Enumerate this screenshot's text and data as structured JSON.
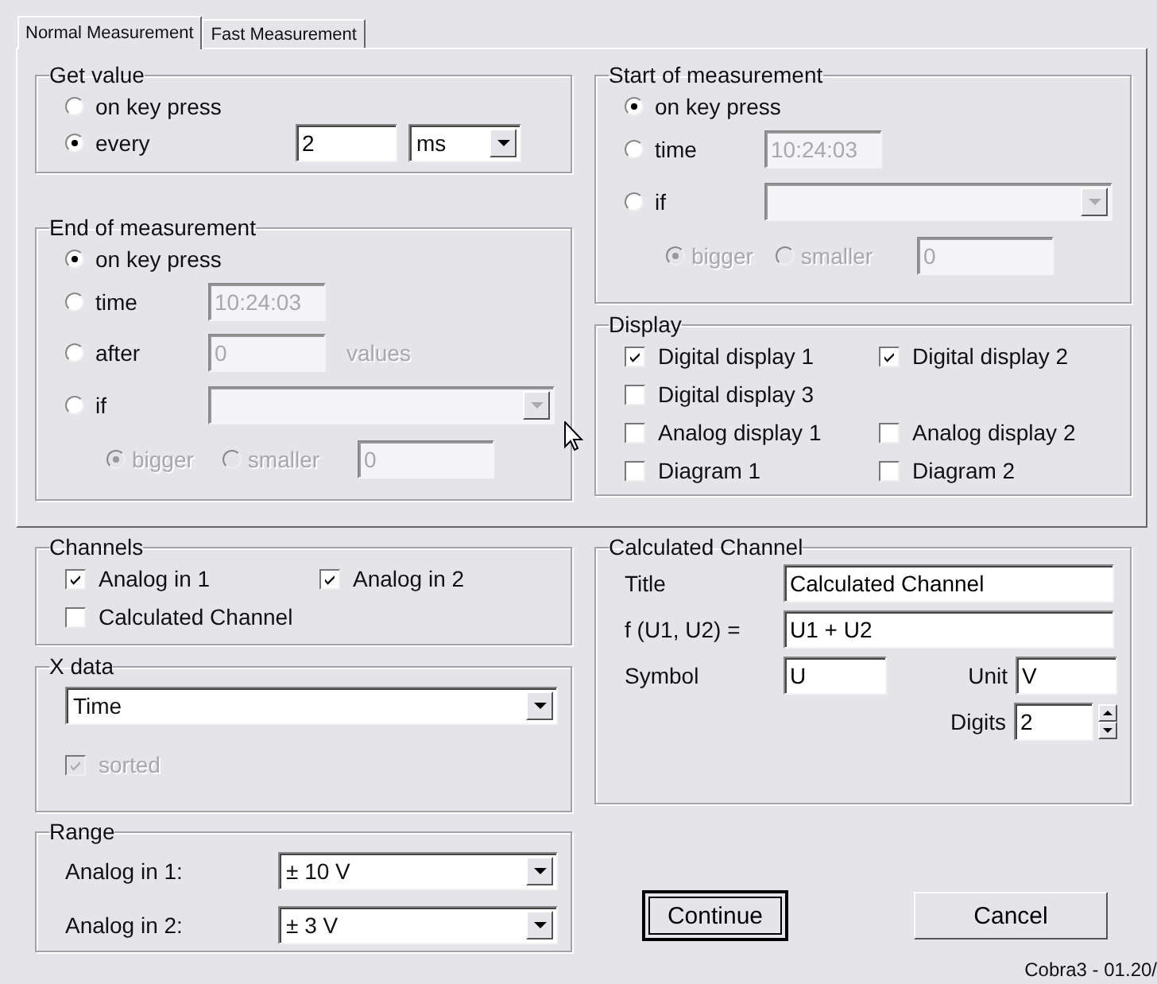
{
  "tabs": [
    {
      "label": "Normal Measurement",
      "selected": true
    },
    {
      "label": "Fast Measurement",
      "selected": false
    }
  ],
  "get_value": {
    "title": "Get value",
    "options": [
      {
        "kind": "plain",
        "label": "on key press",
        "selected": false
      },
      {
        "kind": "interval",
        "label": "every",
        "selected": true,
        "value": "2",
        "unit": "ms"
      }
    ]
  },
  "end_of_measurement": {
    "title": "End of measurement",
    "options": [
      {
        "kind": "plain",
        "label": "on key press",
        "selected": true
      },
      {
        "kind": "field",
        "label": "time",
        "selected": false,
        "value": "10:24:03",
        "disabled": true
      },
      {
        "kind": "field",
        "label": "after",
        "selected": false,
        "value": "0",
        "suffix": "values",
        "disabled": true
      },
      {
        "kind": "dropdown",
        "label": "if",
        "selected": false,
        "disabled": true
      }
    ],
    "comparison": {
      "disabled": true,
      "options": [
        {
          "label": "bigger",
          "selected": true
        },
        {
          "label": "smaller",
          "selected": false
        }
      ],
      "value": "0"
    }
  },
  "start_of_measurement": {
    "title": "Start of measurement",
    "options": [
      {
        "kind": "plain",
        "label": "on key press",
        "selected": true
      },
      {
        "kind": "field",
        "label": "time",
        "selected": false,
        "value": "10:24:03",
        "disabled": true
      },
      {
        "kind": "dropdown",
        "label": "if",
        "selected": false,
        "disabled": true
      }
    ],
    "comparison": {
      "disabled": true,
      "options": [
        {
          "label": "bigger",
          "selected": true
        },
        {
          "label": "smaller",
          "selected": false
        }
      ],
      "value": "0"
    }
  },
  "display": {
    "title": "Display",
    "rows": [
      [
        {
          "label": "Digital display 1",
          "checked": true
        },
        {
          "label": "Digital display 2",
          "checked": true
        }
      ],
      [
        {
          "label": "Digital display 3",
          "checked": false
        }
      ],
      [
        {
          "label": "Analog display 1",
          "checked": false
        },
        {
          "label": "Analog display 2",
          "checked": false
        }
      ],
      [
        {
          "label": "Diagram 1",
          "checked": false
        },
        {
          "label": "Diagram 2",
          "checked": false
        }
      ]
    ]
  },
  "channels": {
    "title": "Channels",
    "rows": [
      [
        {
          "label": "Analog in 1",
          "checked": true
        },
        {
          "label": "Analog in 2",
          "checked": true
        }
      ],
      [
        {
          "label": "Calculated Channel",
          "checked": false
        }
      ]
    ]
  },
  "x_data": {
    "title": "X data",
    "value": "Time",
    "sorted": {
      "label": "sorted",
      "checked": true,
      "disabled": true
    }
  },
  "range": {
    "title": "Range",
    "rows": [
      {
        "label": "Analog in 1:",
        "value": "± 10 V"
      },
      {
        "label": "Analog in 2:",
        "value": "± 3 V"
      }
    ]
  },
  "calculated_channel": {
    "title": "Calculated Channel",
    "title_label": "Title",
    "title_value": "Calculated Channel",
    "formula_label": "f (U1, U2) =",
    "formula_value": "U1 + U2",
    "symbol_label": "Symbol",
    "symbol_value": "U",
    "unit_label": "Unit",
    "unit_value": "V",
    "digits_label": "Digits",
    "digits_value": "2"
  },
  "buttons": [
    {
      "label": "Continue",
      "focused": true
    },
    {
      "label": "Cancel",
      "focused": false
    }
  ],
  "footer": "Cobra3 - 01.20/"
}
